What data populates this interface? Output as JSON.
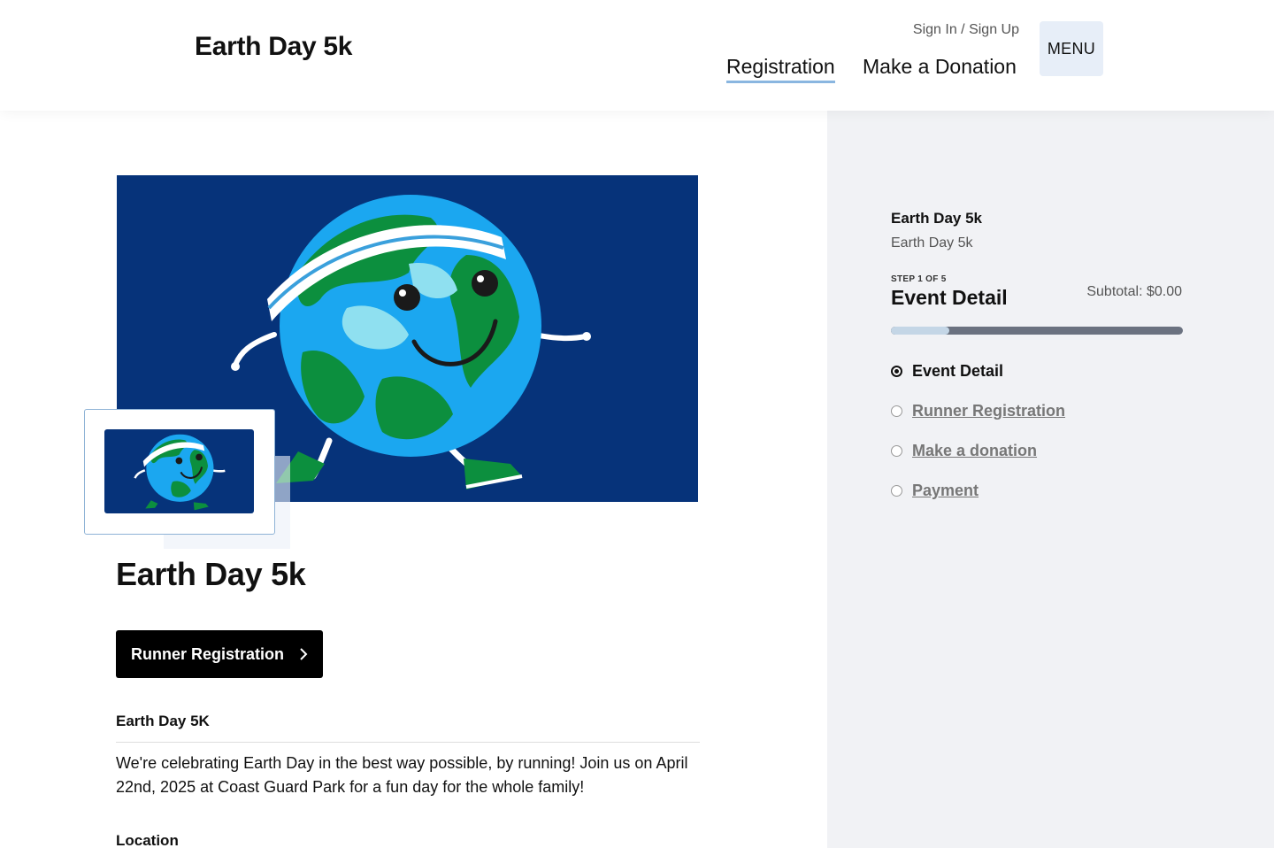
{
  "header": {
    "site_title": "Earth Day 5k",
    "auth_link": "Sign In / Sign Up",
    "nav": {
      "registration": "Registration",
      "donation": "Make a Donation"
    },
    "menu_label": "MENU"
  },
  "main": {
    "title": "Earth Day 5k",
    "register_button": "Runner Registration",
    "description_heading": "Earth Day 5K",
    "description": "We're celebrating Earth Day in the best way possible, by running! Join us on April 22nd, 2025 at Coast Guard Park for a fun day for the whole family!",
    "location_heading": "Location"
  },
  "sidebar": {
    "event_name": "Earth Day 5k",
    "event_subtitle": "Earth Day 5k",
    "step_indicator": "STEP 1 OF 5",
    "step_title": "Event Detail",
    "subtotal": "Subtotal: $0.00",
    "progress_fraction": 0.2,
    "steps": [
      {
        "label": "Event Detail",
        "active": true
      },
      {
        "label": "Runner Registration",
        "active": false
      },
      {
        "label": "Make a donation",
        "active": false
      },
      {
        "label": "Payment",
        "active": false
      }
    ]
  },
  "colors": {
    "banner_bg": "#06337a",
    "ocean": "#1ba7f0",
    "land": "#0c8f3e",
    "accent": "#8ab6e0",
    "button_bg": "#000000",
    "sidebar_bg": "#f1f2f5"
  },
  "icons": {
    "register_chevron": "chevron-right-icon"
  }
}
